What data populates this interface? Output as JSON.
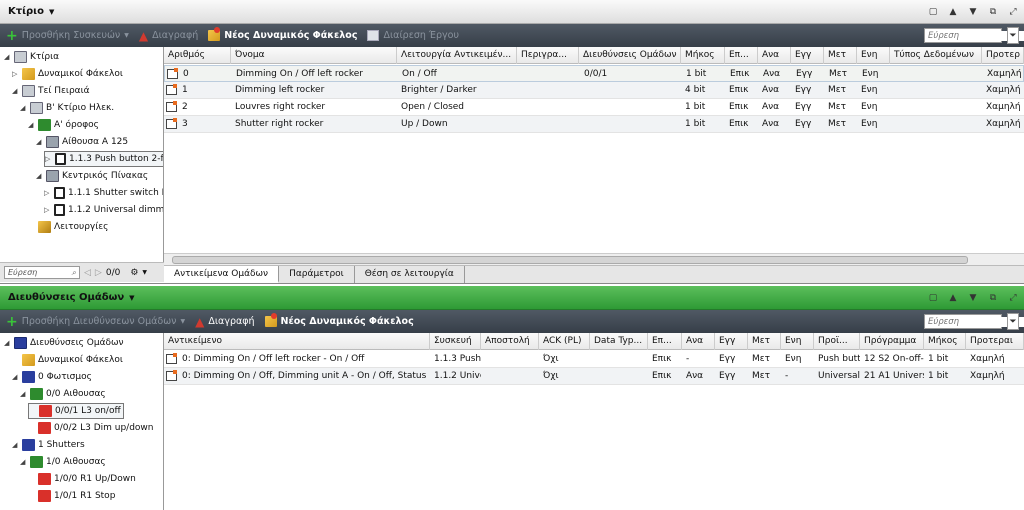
{
  "top": {
    "title": "Κτίριο",
    "toolbar": {
      "add_devices": "Προσθήκη Συσκευών",
      "delete": "Διαγραφή",
      "new_dynamic_folder": "Νέος Δυναμικός Φάκελος",
      "split_project": "Διαίρεση Έργου"
    },
    "search_placeholder": "Εύρεση",
    "tree": [
      {
        "label": "Κτίρια",
        "icon": "building-icon",
        "indent": 0,
        "toggle": "◢"
      },
      {
        "label": "Δυναμικοί Φάκελοι",
        "icon": "dynamic-folder-icon",
        "indent": 1,
        "toggle": "▷"
      },
      {
        "label": "Τεί Πειραιά",
        "icon": "building-icon",
        "indent": 1,
        "toggle": "◢"
      },
      {
        "label": "Β' Κτίριο Ηλεκ.",
        "icon": "building-icon",
        "indent": 2,
        "toggle": "◢"
      },
      {
        "label": "Α' όροφος",
        "icon": "floor-icon",
        "indent": 3,
        "toggle": "◢"
      },
      {
        "label": "Αίθουσα Α 125",
        "icon": "room-icon",
        "indent": 4,
        "toggle": "◢"
      },
      {
        "label": "1.1.3  Push button 2-f UP...",
        "icon": "device-icon",
        "indent": 5,
        "toggle": "▷",
        "selected": true
      },
      {
        "label": "Κεντρικός Πίνακας",
        "icon": "room-icon",
        "indent": 4,
        "toggle": "◢"
      },
      {
        "label": "1.1.1  Shutter switch N 521",
        "icon": "device-icon",
        "indent": 5,
        "toggle": "▷"
      },
      {
        "label": "1.1.2  Universal dimmer...",
        "icon": "device-icon",
        "indent": 5,
        "toggle": "▷"
      },
      {
        "label": "Λειτουργίες",
        "icon": "functions-icon",
        "indent": 3,
        "toggle": ""
      }
    ],
    "tree_footer": {
      "search": "Εύρεση",
      "counter": "0/0"
    },
    "columns": [
      "Αριθμός",
      "Όνομα",
      "Λειτουργία Αντικειμέν...",
      "Περιγρα...",
      "Διευθύνσεις Ομάδων",
      "Μήκος",
      "Επ...",
      "Ανα",
      "Εγγ",
      "Μετ",
      "Ενη",
      "Τύπος Δεδομένων",
      "Προτερ"
    ],
    "rows": [
      [
        "0",
        "Dimming On / Off left rocker",
        "On / Off",
        "",
        "0/0/1",
        "1 bit",
        "Επικ",
        "Ανα",
        "Εγγ",
        "Μετ",
        "Ενη",
        "",
        "Χαμηλή"
      ],
      [
        "1",
        "Dimming left rocker",
        "Brighter / Darker",
        "",
        "",
        "4 bit",
        "Επικ",
        "Ανα",
        "Εγγ",
        "Μετ",
        "Ενη",
        "",
        "Χαμηλή"
      ],
      [
        "2",
        "Louvres right rocker",
        "Open / Closed",
        "",
        "",
        "1 bit",
        "Επικ",
        "Ανα",
        "Εγγ",
        "Μετ",
        "Ενη",
        "",
        "Χαμηλή"
      ],
      [
        "3",
        "Shutter right rocker",
        "Up / Down",
        "",
        "",
        "1 bit",
        "Επικ",
        "Ανα",
        "Εγγ",
        "Μετ",
        "Ενη",
        "",
        "Χαμηλή"
      ]
    ],
    "tabs": [
      "Αντικείμενα Ομάδων",
      "Παράμετροι",
      "Θέση σε λειτουργία"
    ]
  },
  "bottom": {
    "title": "Διευθύνσεις Ομάδων",
    "toolbar": {
      "add_addresses": "Προσθήκη Διευθύνσεων Ομάδων",
      "delete": "Διαγραφή",
      "new_dynamic_folder": "Νέος Δυναμικός Φάκελος"
    },
    "search_placeholder": "Εύρεση",
    "tree": [
      {
        "label": "Διευθύνσεις Ομάδων",
        "icon": "group-addresses-icon",
        "indent": 0,
        "toggle": "◢"
      },
      {
        "label": "Δυναμικοί Φάκελοι",
        "icon": "dynamic-folder-icon",
        "indent": 1,
        "toggle": ""
      },
      {
        "label": "0 Φωτισμος",
        "icon": "main-group-icon",
        "indent": 1,
        "toggle": "◢"
      },
      {
        "label": "0/0 Αιθουσας",
        "icon": "middle-group-icon",
        "indent": 2,
        "toggle": "◢"
      },
      {
        "label": "0/0/1 L3 on/off",
        "icon": "group-address-icon",
        "indent": 3,
        "toggle": "",
        "selected": true
      },
      {
        "label": "0/0/2 L3 Dim up/down",
        "icon": "group-address-icon",
        "indent": 3,
        "toggle": ""
      },
      {
        "label": "1 Shutters",
        "icon": "main-group-icon",
        "indent": 1,
        "toggle": "◢"
      },
      {
        "label": "1/0 Αιθουσας",
        "icon": "middle-group-icon",
        "indent": 2,
        "toggle": "◢"
      },
      {
        "label": "1/0/0 R1 Up/Down",
        "icon": "group-address-icon",
        "indent": 3,
        "toggle": ""
      },
      {
        "label": "1/0/1 R1 Stop",
        "icon": "group-address-icon",
        "indent": 3,
        "toggle": ""
      }
    ],
    "columns": [
      "Αντικείμενο",
      "Συσκευή",
      "Αποστολή",
      "ACK (PL)",
      "Data Typ...",
      "Επ...",
      "Ανα",
      "Εγγ",
      "Μετ",
      "Ενη",
      "Προϊ...",
      "Πρόγραμμα",
      "Μήκος",
      "Προτεραι"
    ],
    "rows": [
      [
        "0: Dimming On / Off left rocker - On / Off",
        "1.1.3  Push b",
        "",
        "Όχι",
        "",
        "Επικ",
        "-",
        "Εγγ",
        "Μετ",
        "Ενη",
        "Push butto",
        "12 S2 On-off-tc",
        "1 bit",
        "Χαμηλή"
      ],
      [
        "0: Dimming On / Off, Dimming unit A - On / Off, Status",
        "1.1.2  Univers",
        "",
        "Όχι",
        "",
        "Επικ",
        "Ανα",
        "Εγγ",
        "Μετ",
        "-",
        "Universal c",
        "21 A1 Universal",
        "1 bit",
        "Χαμηλή"
      ]
    ]
  }
}
